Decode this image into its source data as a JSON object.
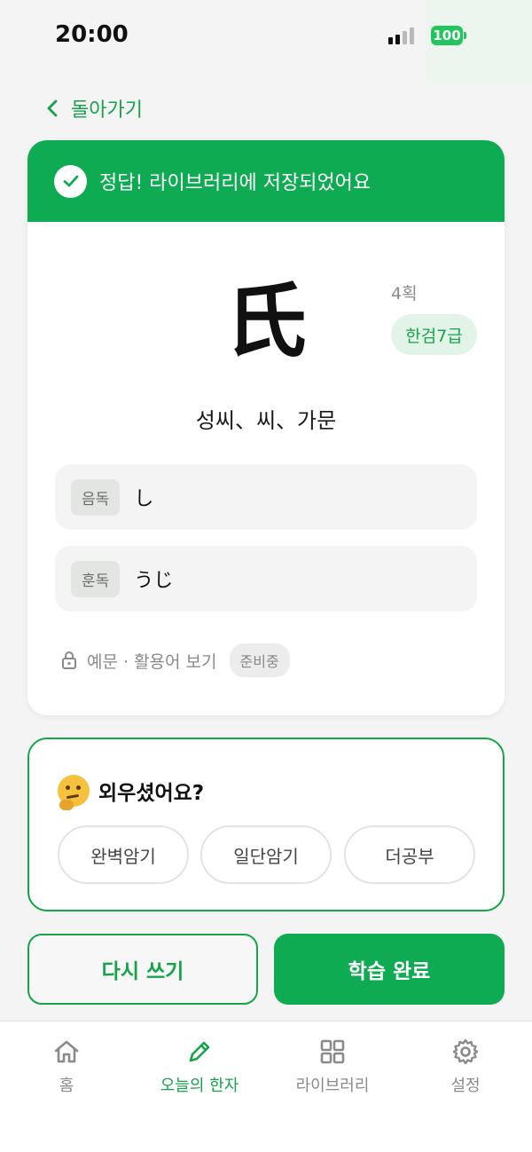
{
  "status": {
    "time": "20:00",
    "battery": "100"
  },
  "nav": {
    "back_label": "돌아가기"
  },
  "result": {
    "banner_text": "정답! 라이브러리에 저장되었어요",
    "hanja": "氏",
    "strokes": "4획",
    "level": "한검7급",
    "meaning": "성씨、씨、가문",
    "readings": [
      {
        "type": "음독",
        "value": "し"
      },
      {
        "type": "훈독",
        "value": "うじ"
      }
    ],
    "examples_label": "예문 · 활용어 보기",
    "examples_badge": "준비중"
  },
  "memorize": {
    "title": "외우셨어요?",
    "options": [
      "완벽암기",
      "일단암기",
      "더공부"
    ]
  },
  "actions": {
    "rewrite": "다시 쓰기",
    "complete": "학습 완료"
  },
  "tabs": [
    {
      "label": "홈",
      "icon": "home-icon"
    },
    {
      "label": "오늘의 한자",
      "icon": "pencil-icon"
    },
    {
      "label": "라이브러리",
      "icon": "grid-icon"
    },
    {
      "label": "설정",
      "icon": "gear-icon"
    }
  ],
  "colors": {
    "accent": "#0fab53",
    "accent_soft": "#e2f4e7",
    "background": "#f4f4f4"
  }
}
